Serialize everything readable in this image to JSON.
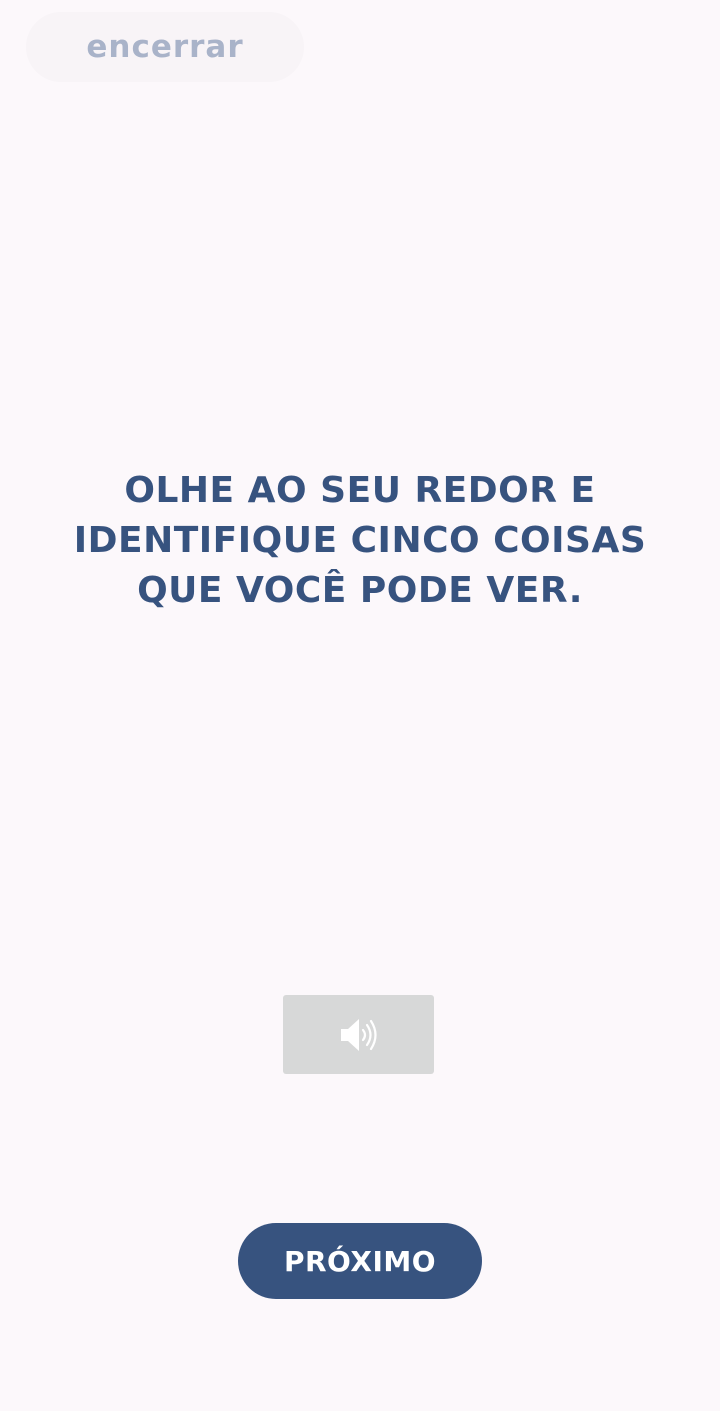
{
  "header": {
    "close_label": "encerrar"
  },
  "main": {
    "instruction": "OLHE AO SEU REDOR E IDENTIFIQUE CINCO COISAS QUE VOCÊ PODE VER."
  },
  "audio": {
    "icon": "speaker-volume-icon"
  },
  "footer": {
    "next_label": "PRÓXIMO"
  },
  "colors": {
    "background": "#fcf8fb",
    "accent": "#37537f",
    "close_text": "#a9b3c9",
    "audio_button": "#d7d8d8"
  }
}
